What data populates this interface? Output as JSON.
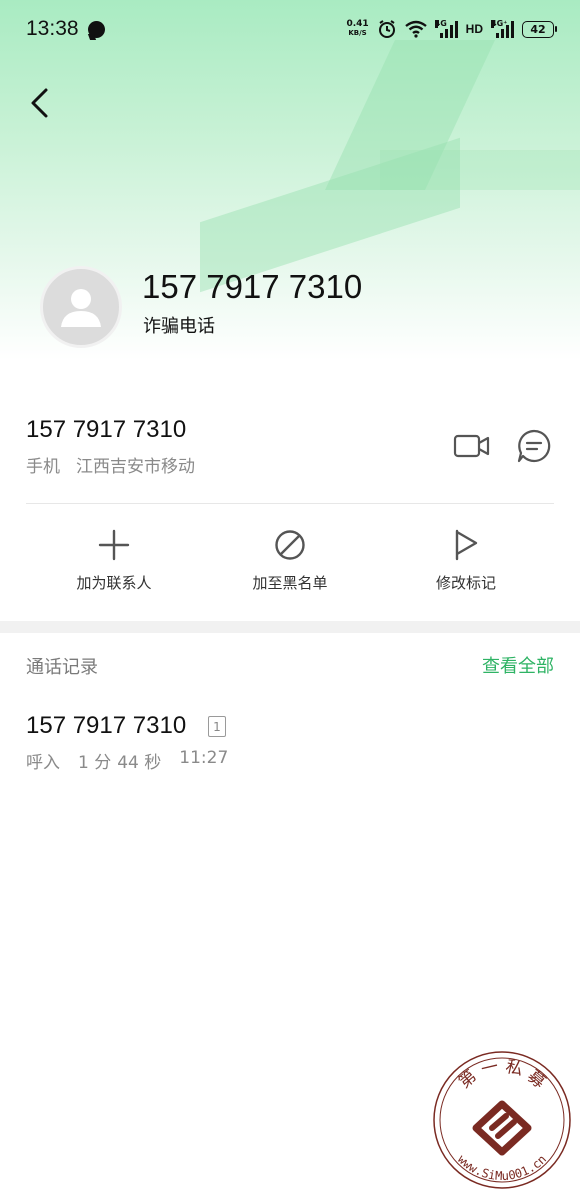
{
  "status_bar": {
    "time": "13:38",
    "net_speed_value": "0.41",
    "net_speed_unit": "KB/S",
    "sig1_tag": "4G",
    "sig2_tag": "4G⁺",
    "hd_label": "HD",
    "battery": "42"
  },
  "contact": {
    "header_number": "157 7917 7310",
    "header_tag": "诈骗电话",
    "number": "157 7917 7310",
    "phone_type": "手机",
    "location": "江西吉安市移动"
  },
  "actions": [
    {
      "label": "加为联系人",
      "icon": "plus-icon"
    },
    {
      "label": "加至黑名单",
      "icon": "block-icon"
    },
    {
      "label": "修改标记",
      "icon": "flag-icon"
    }
  ],
  "call_log": {
    "title": "通话记录",
    "view_all": "查看全部",
    "entries": [
      {
        "number": "157 7917 7310",
        "sim": "1",
        "direction": "呼入",
        "duration_min": "1 分",
        "duration_sec": "44 秒",
        "time": "11:27"
      }
    ]
  },
  "watermark": {
    "top_text": "第 一 私 募",
    "url_text": "www.SiMu001.cn"
  },
  "colors": {
    "accent": "#2eb364",
    "hero_green": "#a9ebc2"
  }
}
